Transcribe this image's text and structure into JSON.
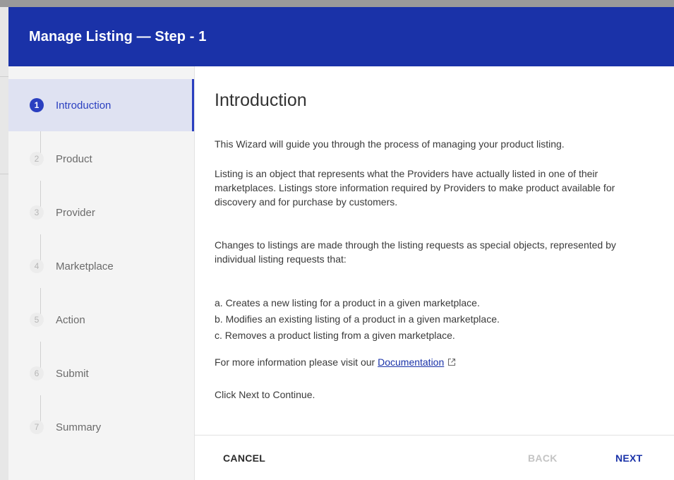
{
  "dialog": {
    "title": "Manage Listing — Step - 1"
  },
  "steps": [
    {
      "number": "1",
      "label": "Introduction",
      "active": true
    },
    {
      "number": "2",
      "label": "Product",
      "active": false
    },
    {
      "number": "3",
      "label": "Provider",
      "active": false
    },
    {
      "number": "4",
      "label": "Marketplace",
      "active": false
    },
    {
      "number": "5",
      "label": "Action",
      "active": false
    },
    {
      "number": "6",
      "label": "Submit",
      "active": false
    },
    {
      "number": "7",
      "label": "Summary",
      "active": false
    }
  ],
  "content": {
    "heading": "Introduction",
    "intro": "This Wizard will guide you through the process of managing your product listing.",
    "listing_desc": "Listing is an object that represents what the Providers have actually listed in one of their marketplaces. Listings store information required by Providers to make product available for discovery and for purchase by customers.",
    "changes_desc": "Changes to listings are made through the listing requests as special objects, represented by individual listing requests that:",
    "list_items": [
      "a. Creates a new listing for a product in a given marketplace.",
      "b. Modifies an existing listing of a product in a given marketplace.",
      "c. Removes a product listing from a given marketplace."
    ],
    "more_info_prefix": "For more information please visit our ",
    "doc_link": "Documentation",
    "doc_icon": "external-link-icon",
    "continue_text": "Click Next to Continue."
  },
  "footer": {
    "cancel_label": "CANCEL",
    "back_label": "BACK",
    "next_label": "NEXT"
  },
  "colors": {
    "header_bg": "#1a32a8",
    "accent": "#2a3fc0",
    "active_step_bg": "#dfe2f2",
    "disabled_text": "#c4c4c4"
  }
}
